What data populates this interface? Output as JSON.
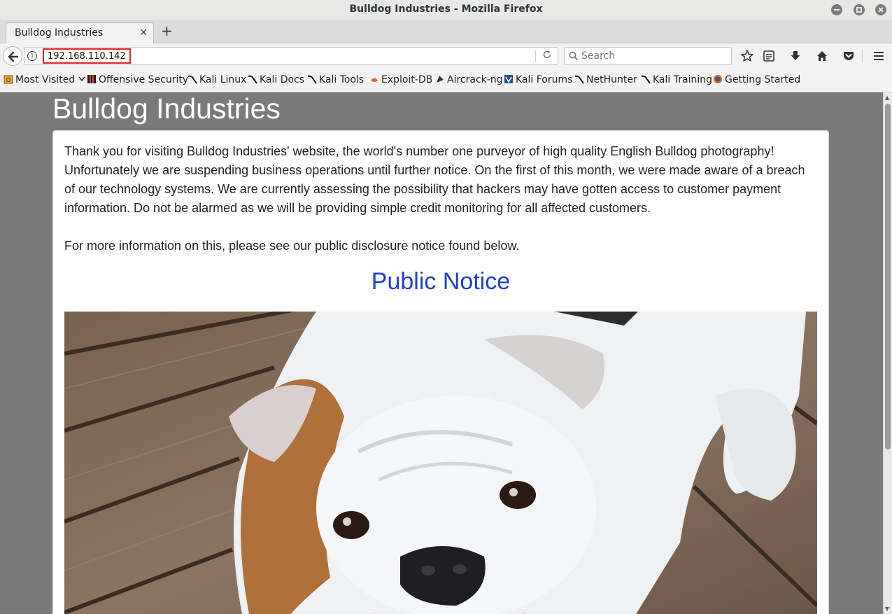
{
  "window": {
    "title": "Bulldog Industries - Mozilla Firefox"
  },
  "tabs": [
    {
      "label": "Bulldog Industries",
      "active": true
    }
  ],
  "navbar": {
    "url": "192.168.110.142",
    "search_placeholder": "Search"
  },
  "bookmarks": [
    {
      "label": "Most Visited",
      "icon": "most-visited-icon"
    },
    {
      "label": "Offensive Security",
      "icon": "offsec-icon"
    },
    {
      "label": "Kali Linux",
      "icon": "kali-icon"
    },
    {
      "label": "Kali Docs",
      "icon": "kali-icon"
    },
    {
      "label": "Kali Tools",
      "icon": "kali-icon"
    },
    {
      "label": "Exploit-DB",
      "icon": "exploitdb-icon"
    },
    {
      "label": "Aircrack-ng",
      "icon": "aircrack-icon"
    },
    {
      "label": "Kali Forums",
      "icon": "kali-forums-icon"
    },
    {
      "label": "NetHunter",
      "icon": "kali-icon"
    },
    {
      "label": "Kali Training",
      "icon": "kali-icon"
    },
    {
      "label": "Getting Started",
      "icon": "firefox-icon"
    }
  ],
  "page": {
    "site_title": "Bulldog Industries",
    "paragraph1": "Thank you for visiting Bulldog Industries' website, the world's number one purveyor of high quality English Bulldog photography! Unfortunately we are suspending business operations until further notice. On the first of this month, we were made aware of a breach of our technology systems. We are currently assessing the possibility that hackers may have gotten access to customer payment information. Do not be alarmed as we will be providing simple credit monitoring for all affected customers.",
    "paragraph2": "For more information on this, please see our public disclosure notice found below.",
    "notice_link": "Public Notice"
  },
  "colors": {
    "page_background": "#7a7a7a",
    "link": "#1f3fd4",
    "url_highlight": "#e02424"
  }
}
